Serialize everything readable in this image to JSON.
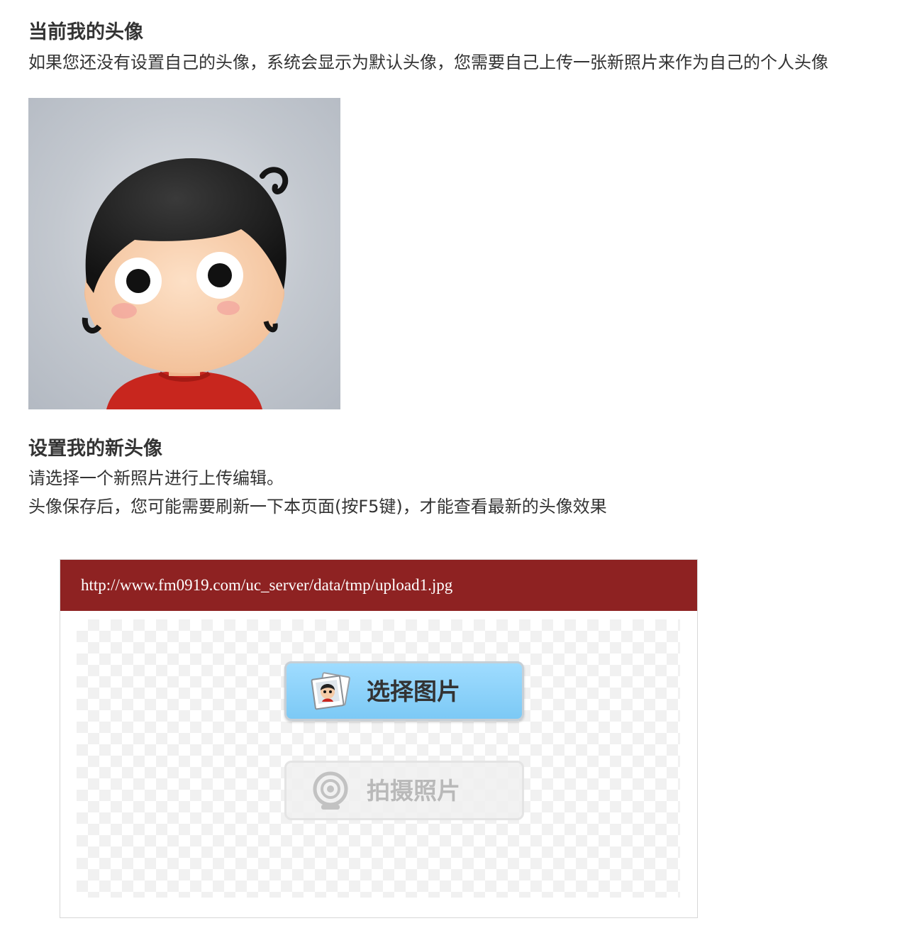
{
  "current_avatar": {
    "title": "当前我的头像",
    "description": "如果您还没有设置自己的头像，系统会显示为默认头像，您需要自己上传一张新照片来作为自己的个人头像"
  },
  "new_avatar": {
    "title": "设置我的新头像",
    "description_1": "请选择一个新照片进行上传编辑。",
    "description_2": "头像保存后，您可能需要刷新一下本页面(按F5键)，才能查看最新的头像效果"
  },
  "uploader": {
    "url": "http://www.fm0919.com/uc_server/data/tmp/upload1.jpg",
    "select_button": {
      "label": "选择图片",
      "icon": "photo-stack-icon"
    },
    "camera_button": {
      "label": "拍摄照片",
      "icon": "webcam-icon",
      "state": "disabled"
    },
    "header_color": "#8e2222",
    "select_color": "#8fd3fb"
  }
}
